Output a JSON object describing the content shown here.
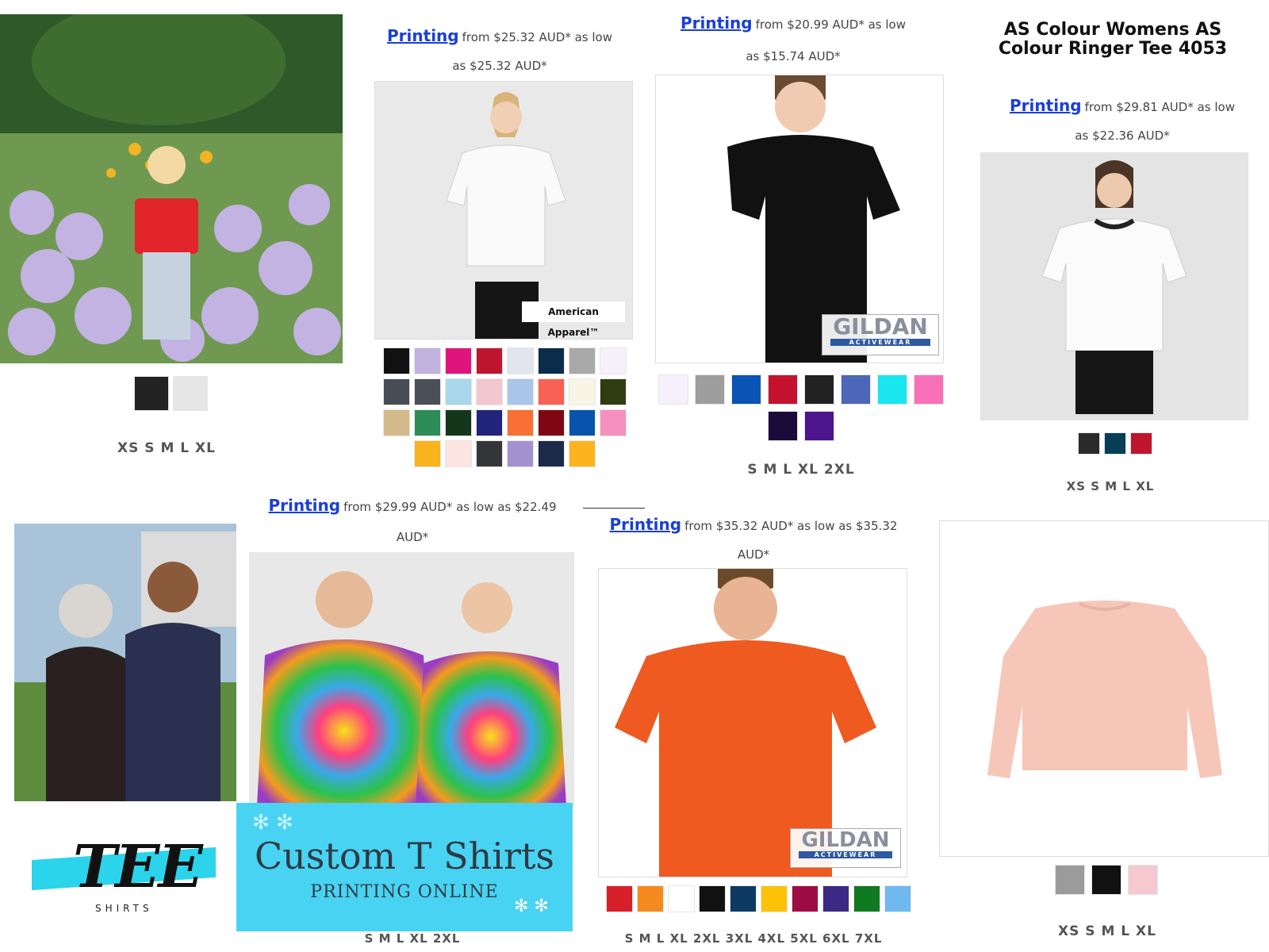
{
  "printing_link": "Printing",
  "products": [
    {
      "id": "p1",
      "colors": [
        "#222222",
        "#e6e6e6"
      ],
      "sizes": "XS S M L XL"
    },
    {
      "id": "p2",
      "price_from": "from $25.32 AUD* as low",
      "price_low": "as $25.32 AUD*",
      "brand": "American Apparel™",
      "colors": [
        "#111111",
        "#c2b2e0",
        "#e0157b",
        "#c0152f",
        "#e3e5ee",
        "#0a2d4a",
        "#a9a9a9",
        "#f5f0fa",
        "#474c55",
        "#4b4f57",
        "#a8d8ea",
        "#f2c7cf",
        "#a9c6e8",
        "#f96155",
        "#f8f5e6",
        "#2f3d10",
        "#d4b98b",
        "#2d8c57",
        "#15361a",
        "#22237a",
        "#f96f34",
        "#7e0713",
        "#0854ad",
        "#f691bf",
        "#f8b31e",
        "#fde4e1",
        "#333539",
        "#a392d0",
        "#1d2b4b",
        "#fcb41e"
      ],
      "sizes": ""
    },
    {
      "id": "p3",
      "price_from": "from $20.99 AUD* as low",
      "price_low": "as $15.74 AUD*",
      "brand": "GILDAN",
      "brand_sub": "ACTIVEWEAR",
      "colors": [
        "#f5f0fb",
        "#9e9e9e",
        "#0a54b5",
        "#c5122e",
        "#222222",
        "#4c66b8",
        "#19e6ef",
        "#f870b8",
        "#1a0b3a",
        "#4c148d"
      ],
      "sizes": "S M L XL 2XL"
    },
    {
      "id": "p4",
      "title": "AS Colour Womens AS Colour Ringer Tee 4053",
      "price_from": "from $29.81 AUD* as low",
      "price_low": "as $22.36 AUD*",
      "colors": [
        "#2a2a2a",
        "#053e56",
        "#c0152f"
      ],
      "sizes": "XS S M L XL"
    },
    {
      "id": "p5",
      "price_from": "from $29.99 AUD* as low as $22.49",
      "price_low": "AUD*",
      "sizes": "S M L XL 2XL"
    },
    {
      "id": "p6",
      "price_from": "from $35.32 AUD* as low as $35.32",
      "price_low": "AUD*",
      "brand": "GILDAN",
      "brand_sub": "ACTIVEWEAR",
      "colors": [
        "#d71f2a",
        "#f58b1f",
        "#ffffff",
        "#111111",
        "#0c3a63",
        "#fcc208",
        "#9e0c44",
        "#3b2a83",
        "#107a21",
        "#6fb9f0"
      ],
      "sizes": "S M L XL 2XL 3XL 4XL 5XL 6XL 7XL"
    },
    {
      "id": "p7",
      "colors": [
        "#9b9b9b",
        "#111111",
        "#f5c9cf"
      ],
      "sizes": "XS S M L XL"
    }
  ],
  "banner": {
    "title": "Custom T Shirts",
    "subtitle": "PRINTING ONLINE"
  },
  "logo": {
    "text": "TEE",
    "sub": "SHIRTS"
  }
}
